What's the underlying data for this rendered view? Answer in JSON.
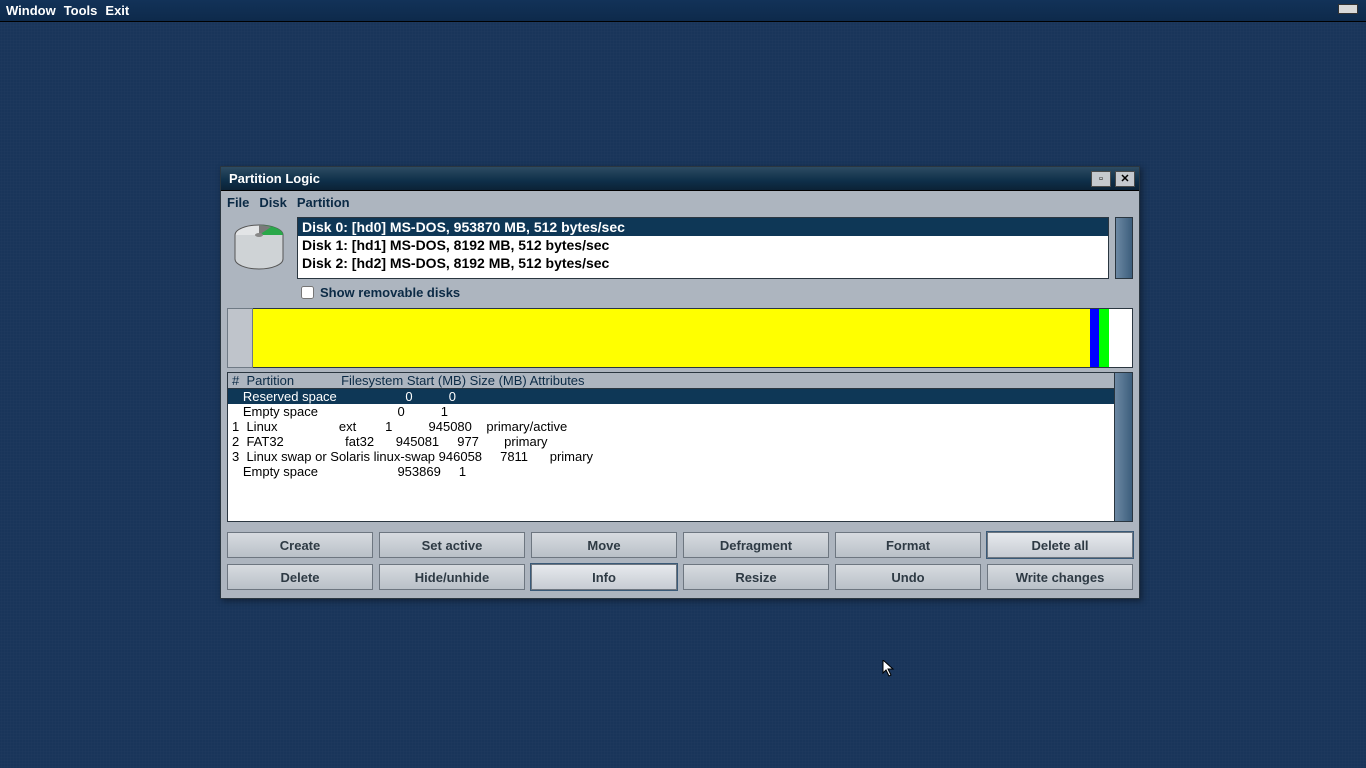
{
  "topbar": {
    "window": "Window",
    "tools": "Tools",
    "exit": "Exit"
  },
  "win": {
    "title": "Partition Logic",
    "menu_file": "File",
    "menu_disk": "Disk",
    "menu_partition": "Partition",
    "show_removable": "Show removable disks"
  },
  "disks": [
    "Disk 0: [hd0] MS-DOS, 953870 MB, 512 bytes/sec",
    "Disk 1: [hd1] MS-DOS, 8192 MB, 512 bytes/sec",
    "Disk 2: [hd2] MS-DOS, 8192 MB, 512 bytes/sec"
  ],
  "selected_disk": 0,
  "viz": {
    "yellow_pct": 95.2,
    "blue_pct": 1.1,
    "green_pct": 1.1,
    "white_pct": 2.6
  },
  "columns": {
    "num": "#",
    "part": "Partition",
    "fs": "Filesystem",
    "start": "Start (MB)",
    "size": "Size (MB)",
    "attr": "Attributes"
  },
  "rows": [
    {
      "num": "",
      "part": "Reserved space",
      "fs": "",
      "start": "0",
      "size": "0",
      "attr": ""
    },
    {
      "num": "",
      "part": "Empty space",
      "fs": "",
      "start": "0",
      "size": "1",
      "attr": ""
    },
    {
      "num": "1",
      "part": "Linux",
      "fs": "ext",
      "start": "1",
      "size": "945080",
      "attr": "primary/active"
    },
    {
      "num": "2",
      "part": "FAT32",
      "fs": "fat32",
      "start": "945081",
      "size": "977",
      "attr": "primary"
    },
    {
      "num": "3",
      "part": "Linux swap or Solaris",
      "fs": "linux-swap",
      "start": "946058",
      "size": "7811",
      "attr": "primary"
    },
    {
      "num": "",
      "part": "Empty space",
      "fs": "",
      "start": "953869",
      "size": "1",
      "attr": ""
    }
  ],
  "selected_row": 0,
  "buttons": {
    "create": "Create",
    "set_active": "Set active",
    "move": "Move",
    "defragment": "Defragment",
    "format": "Format",
    "delete_all": "Delete all",
    "delete": "Delete",
    "hide": "Hide/unhide",
    "info": "Info",
    "resize": "Resize",
    "undo": "Undo",
    "write": "Write changes"
  }
}
